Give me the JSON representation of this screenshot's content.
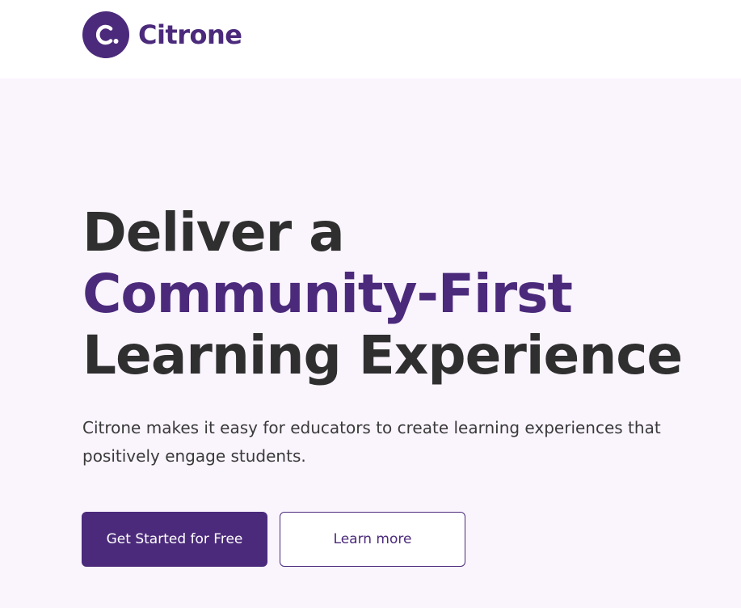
{
  "header": {
    "logo_mark": "c.",
    "brand_name": "Citrone"
  },
  "hero": {
    "headline_line1": "Deliver a",
    "headline_line2": "Community-First",
    "headline_line3": "Learning Experience",
    "subtext": "Citrone makes it easy for educators to create learning experiences that positively engage students.",
    "primary_cta": "Get Started for Free",
    "secondary_cta": "Learn more"
  },
  "colors": {
    "brand": "#4b2a7b",
    "hero_background": "#faf4fd",
    "heading_text": "#2f2f2f"
  }
}
